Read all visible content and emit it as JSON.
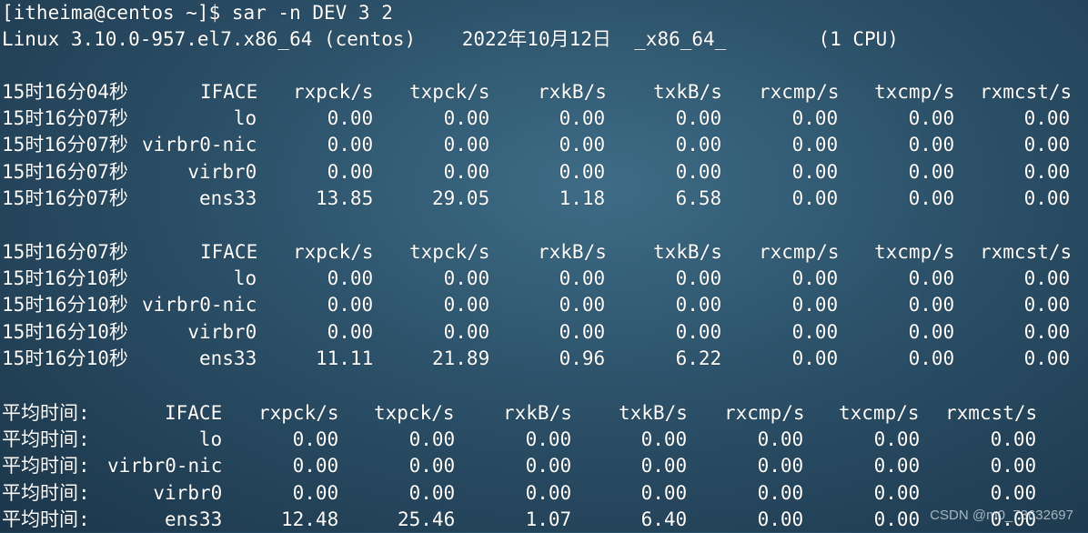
{
  "terminal": {
    "prompt": "[itheima@centos ~]$ sar -n DEV 3 2",
    "sysinfo": "Linux 3.10.0-957.el7.x86_64 (centos)    2022年10月12日  _x86_64_        (1 CPU)",
    "headers": [
      "IFACE",
      "rxpck/s",
      "txpck/s",
      "rxkB/s",
      "txkB/s",
      "rxcmp/s",
      "txcmp/s",
      "rxmcst/s"
    ],
    "blocks": [
      {
        "header_time": "15时16分04秒",
        "rows": [
          {
            "time": "15时16分07秒",
            "iface": "lo",
            "values": [
              "0.00",
              "0.00",
              "0.00",
              "0.00",
              "0.00",
              "0.00",
              "0.00"
            ]
          },
          {
            "time": "15时16分07秒",
            "iface": "virbr0-nic",
            "values": [
              "0.00",
              "0.00",
              "0.00",
              "0.00",
              "0.00",
              "0.00",
              "0.00"
            ]
          },
          {
            "time": "15时16分07秒",
            "iface": "virbr0",
            "values": [
              "0.00",
              "0.00",
              "0.00",
              "0.00",
              "0.00",
              "0.00",
              "0.00"
            ]
          },
          {
            "time": "15时16分07秒",
            "iface": "ens33",
            "values": [
              "13.85",
              "29.05",
              "1.18",
              "6.58",
              "0.00",
              "0.00",
              "0.00"
            ]
          }
        ]
      },
      {
        "header_time": "15时16分07秒",
        "rows": [
          {
            "time": "15时16分10秒",
            "iface": "lo",
            "values": [
              "0.00",
              "0.00",
              "0.00",
              "0.00",
              "0.00",
              "0.00",
              "0.00"
            ]
          },
          {
            "time": "15时16分10秒",
            "iface": "virbr0-nic",
            "values": [
              "0.00",
              "0.00",
              "0.00",
              "0.00",
              "0.00",
              "0.00",
              "0.00"
            ]
          },
          {
            "time": "15时16分10秒",
            "iface": "virbr0",
            "values": [
              "0.00",
              "0.00",
              "0.00",
              "0.00",
              "0.00",
              "0.00",
              "0.00"
            ]
          },
          {
            "time": "15时16分10秒",
            "iface": "ens33",
            "values": [
              "11.11",
              "21.89",
              "0.96",
              "6.22",
              "0.00",
              "0.00",
              "0.00"
            ]
          }
        ]
      }
    ],
    "average": {
      "label": "平均时间:",
      "rows": [
        {
          "iface": "lo",
          "values": [
            "0.00",
            "0.00",
            "0.00",
            "0.00",
            "0.00",
            "0.00",
            "0.00"
          ]
        },
        {
          "iface": "virbr0-nic",
          "values": [
            "0.00",
            "0.00",
            "0.00",
            "0.00",
            "0.00",
            "0.00",
            "0.00"
          ]
        },
        {
          "iface": "virbr0",
          "values": [
            "0.00",
            "0.00",
            "0.00",
            "0.00",
            "0.00",
            "0.00",
            "0.00"
          ]
        },
        {
          "iface": "ens33",
          "values": [
            "12.48",
            "25.46",
            "1.07",
            "6.40",
            "0.00",
            "0.00",
            "0.00"
          ]
        }
      ]
    }
  },
  "watermark": "CSDN @m0_73632697",
  "colors": {
    "text": "#ffffff",
    "background": "#2b5068"
  }
}
